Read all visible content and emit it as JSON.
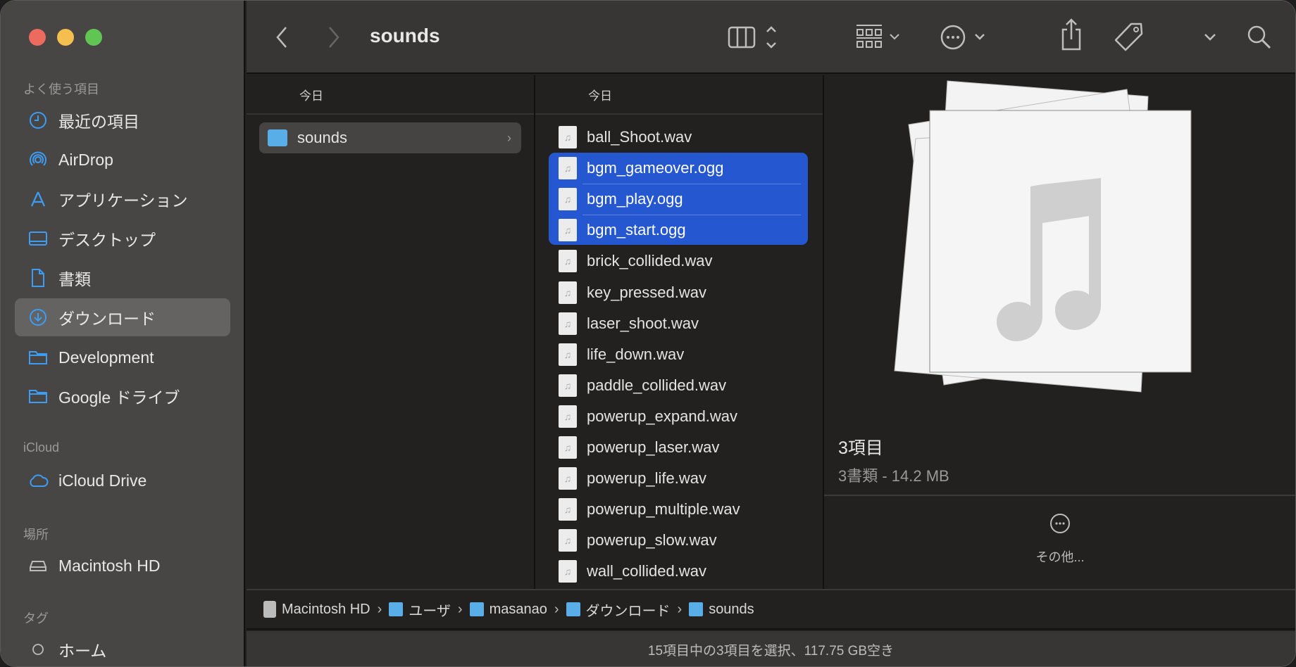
{
  "window": {
    "title": "sounds"
  },
  "sidebar": {
    "sections": [
      {
        "heading": "よく使う項目",
        "items": [
          {
            "label": "最近の項目",
            "icon": "clock-icon"
          },
          {
            "label": "AirDrop",
            "icon": "airdrop-icon"
          },
          {
            "label": "アプリケーション",
            "icon": "applications-icon"
          },
          {
            "label": "デスクトップ",
            "icon": "desktop-icon"
          },
          {
            "label": "書類",
            "icon": "document-icon"
          },
          {
            "label": "ダウンロード",
            "icon": "download-icon",
            "selected": true
          },
          {
            "label": "Development",
            "icon": "folder-icon"
          },
          {
            "label": "Google ドライブ",
            "icon": "folder-icon"
          }
        ]
      },
      {
        "heading": "iCloud",
        "items": [
          {
            "label": "iCloud Drive",
            "icon": "cloud-icon"
          }
        ]
      },
      {
        "heading": "場所",
        "items": [
          {
            "label": "Macintosh HD",
            "icon": "disk-icon"
          }
        ]
      },
      {
        "heading": "タグ",
        "items": [
          {
            "label": "ホーム",
            "icon": "tag-circle-icon"
          }
        ]
      }
    ]
  },
  "columns": [
    {
      "header": "今日",
      "items": [
        "sounds"
      ]
    },
    {
      "header": "今日",
      "items": [
        "ball_Shoot.wav",
        "bgm_gameover.ogg",
        "bgm_play.ogg",
        "bgm_start.ogg",
        "brick_collided.wav",
        "key_pressed.wav",
        "laser_shoot.wav",
        "life_down.wav",
        "paddle_collided.wav",
        "powerup_expand.wav",
        "powerup_laser.wav",
        "powerup_life.wav",
        "powerup_multiple.wav",
        "powerup_slow.wav",
        "wall_collided.wav"
      ],
      "selected": [
        "bgm_gameover.ogg",
        "bgm_play.ogg",
        "bgm_start.ogg"
      ]
    }
  ],
  "preview": {
    "title": "3項目",
    "subtitle": "3書類 - 14.2 MB",
    "more_label": "その他..."
  },
  "pathbar": [
    "Macintosh HD",
    "ユーザ",
    "masanao",
    "ダウンロード",
    "sounds"
  ],
  "status": "15項目中の3項目を選択、117.75 GB空き",
  "colors": {
    "accent": "#2557d0",
    "sidebar_icon": "#3d9df5",
    "folder": "#5aaee8"
  }
}
